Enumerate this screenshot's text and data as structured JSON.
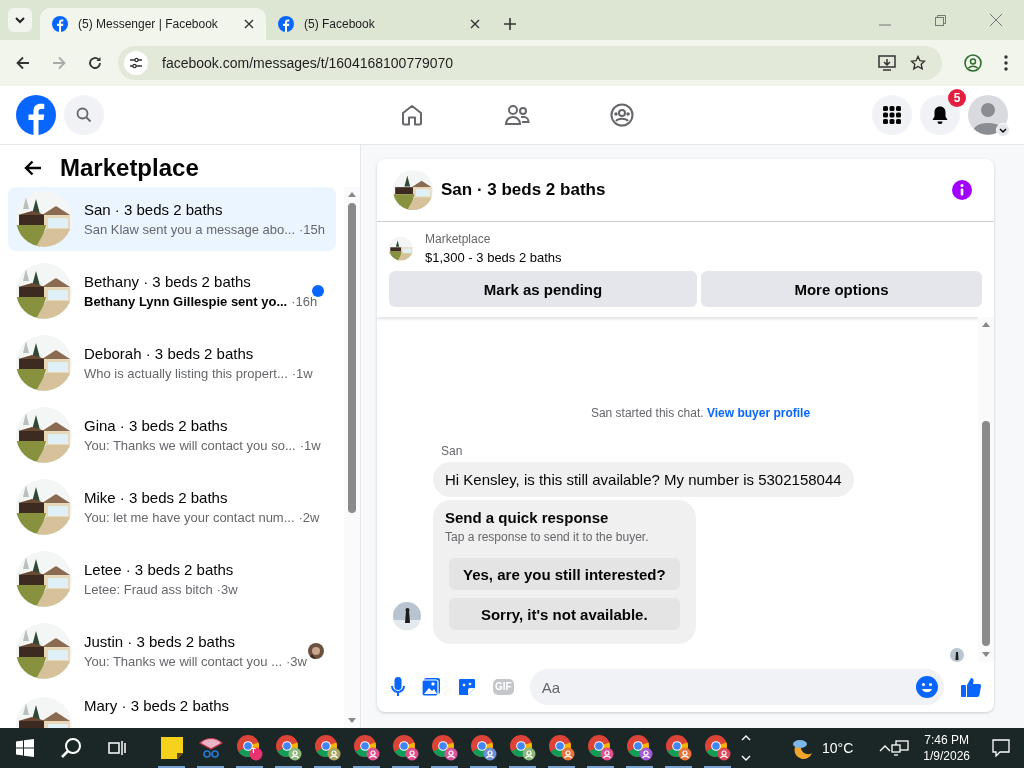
{
  "browser": {
    "tabs": [
      {
        "title": "(5) Messenger | Facebook",
        "selected": true
      },
      {
        "title": "(5) Facebook",
        "selected": false
      }
    ],
    "url": "facebook.com/messages/t/1604168100779070"
  },
  "topnav": {
    "notification_count": "5"
  },
  "sidebar": {
    "title": "Marketplace",
    "conversations": [
      {
        "name": "San · 3 beds 2 baths",
        "preview": "San Klaw sent you a message abo...",
        "time": "·15h",
        "selected": true,
        "unread": false,
        "seen_avatar": false
      },
      {
        "name": "Bethany · 3 beds 2 baths",
        "preview": "Bethany Lynn Gillespie sent yo...",
        "time": "·16h",
        "selected": false,
        "unread": true,
        "seen_avatar": false
      },
      {
        "name": "Deborah · 3 beds 2 baths",
        "preview": "Who is actually listing this propert...",
        "time": "·1w",
        "selected": false,
        "unread": false,
        "seen_avatar": false
      },
      {
        "name": "Gina · 3 beds 2 baths",
        "preview": "You: Thanks we will contact you so...",
        "time": "·1w",
        "selected": false,
        "unread": false,
        "seen_avatar": false
      },
      {
        "name": "Mike · 3 beds 2 baths",
        "preview": "You: let me have your contact num...",
        "time": "·2w",
        "selected": false,
        "unread": false,
        "seen_avatar": false
      },
      {
        "name": "Letee · 3 beds 2 baths",
        "preview": "Letee: Fraud ass bitch",
        "time": "·3w",
        "selected": false,
        "unread": false,
        "seen_avatar": false
      },
      {
        "name": "Justin · 3 beds 2 baths",
        "preview": "You: Thanks we will contact you ...",
        "time": "·3w",
        "selected": false,
        "unread": false,
        "seen_avatar": true
      },
      {
        "name": "Mary · 3 beds 2 baths",
        "selected": false,
        "unread": false,
        "seen_avatar": false
      }
    ]
  },
  "chat": {
    "title": "San · 3 beds 2 baths",
    "listing": {
      "source": "Marketplace",
      "summary": "$1,300 - 3 beds 2 baths",
      "buttons": [
        "Mark as pending",
        "More options"
      ]
    },
    "started": {
      "text": "San started this chat.",
      "link": "View buyer profile"
    },
    "sender": "San",
    "message": "Hi Kensley, is this still available? My number is 5302158044",
    "quick_response": {
      "title": "Send a quick response",
      "hint": "Tap a response to send it to the buyer.",
      "options": [
        "Yes, are you still interested?",
        "Sorry, it's not available."
      ]
    },
    "composer": {
      "gif_label": "GIF",
      "placeholder": "Aa"
    }
  },
  "taskbar": {
    "apps": [
      {
        "kind": "notes"
      },
      {
        "kind": "snip"
      },
      {
        "kind": "chrome",
        "color": "#e8336e",
        "letter": "T"
      },
      {
        "kind": "chrome",
        "color": "#8bb77a"
      },
      {
        "kind": "chrome",
        "color": "#a9a35e"
      },
      {
        "kind": "chrome",
        "color": "#e04e8c"
      },
      {
        "kind": "chrome",
        "color": "#e04e8c"
      },
      {
        "kind": "chrome",
        "color": "#d8559a"
      },
      {
        "kind": "chrome",
        "color": "#6f8fd6"
      },
      {
        "kind": "chrome",
        "color": "#8bb77a"
      },
      {
        "kind": "chrome",
        "color": "#e8733a"
      },
      {
        "kind": "chrome",
        "color": "#e04e8c"
      },
      {
        "kind": "chrome",
        "color": "#a45ad6"
      },
      {
        "kind": "chrome",
        "color": "#e8733a"
      },
      {
        "kind": "chrome",
        "color": "#e0465a"
      }
    ],
    "weather": "10°C",
    "time": "7:46 PM",
    "date": "1/9/2026"
  }
}
